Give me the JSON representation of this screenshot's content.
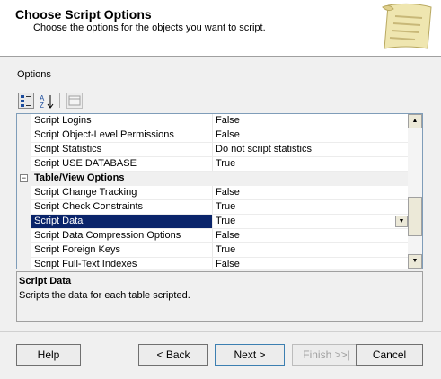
{
  "header": {
    "title": "Choose Script Options",
    "subtitle": "Choose the options for the objects you want to script."
  },
  "options_label": "Options",
  "grid": {
    "rows": [
      {
        "kind": "prop",
        "name": "Script Logins",
        "value": "False"
      },
      {
        "kind": "prop",
        "name": "Script Object-Level Permissions",
        "value": "False"
      },
      {
        "kind": "prop",
        "name": "Script Statistics",
        "value": "Do not script statistics"
      },
      {
        "kind": "prop",
        "name": "Script USE DATABASE",
        "value": "True"
      },
      {
        "kind": "category",
        "name": "Table/View Options",
        "toggle": "−"
      },
      {
        "kind": "prop",
        "name": "Script Change Tracking",
        "value": "False"
      },
      {
        "kind": "prop",
        "name": "Script Check Constraints",
        "value": "True"
      },
      {
        "kind": "prop",
        "name": "Script Data",
        "value": "True",
        "selected": true
      },
      {
        "kind": "prop",
        "name": "Script Data Compression Options",
        "value": "False"
      },
      {
        "kind": "prop",
        "name": "Script Foreign Keys",
        "value": "True"
      },
      {
        "kind": "prop",
        "name": "Script Full-Text Indexes",
        "value": "False"
      }
    ]
  },
  "description": {
    "title": "Script Data",
    "text": "Scripts the data for each table scripted."
  },
  "buttons": {
    "help": "Help",
    "back": "< Back",
    "next": "Next >",
    "finish": "Finish >>|",
    "cancel": "Cancel"
  },
  "icons": {
    "categorized": "categorized-icon",
    "alphabetical": "sort-az-icon",
    "property_pages": "property-pages-icon",
    "header": "script-scroll-icon"
  },
  "colors": {
    "selection": "#0a246a",
    "background": "#f0f0f0"
  }
}
